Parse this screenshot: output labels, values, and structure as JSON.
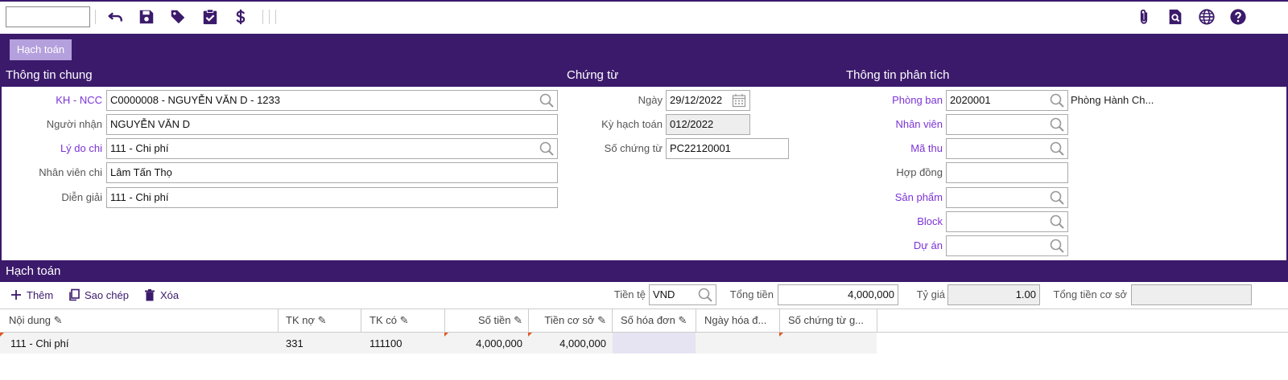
{
  "toolbar": {
    "search_value": "",
    "left_icons": [
      "undo-icon",
      "save-icon",
      "tag-icon",
      "clipboard-check-icon",
      "dollar-icon"
    ],
    "right_icons": [
      "paperclip-icon",
      "document-search-icon",
      "globe-icon",
      "help-icon"
    ],
    "icon_color": "#3b1a6b"
  },
  "tabs": {
    "active": "Hạch toán"
  },
  "sections": {
    "general": "Thông tin chung",
    "voucher": "Chứng từ",
    "analysis": "Thông tin phân tích",
    "accounting": "Hạch toán"
  },
  "general": {
    "customer_label": "KH - NCC",
    "customer_value": "C0000008 - NGUYỄN VĂN D - 1233",
    "receiver_label": "Người nhận",
    "receiver_value": "NGUYỄN VĂN D",
    "reason_label": "Lý do chi",
    "reason_value": "111 - Chi phí",
    "employee_label": "Nhân viên chi",
    "employee_value": "Lâm Tấn Thọ",
    "description_label": "Diễn giải",
    "description_value": "111 - Chi phí"
  },
  "voucher": {
    "date_label": "Ngày",
    "date_value": "29/12/2022",
    "period_label": "Kỳ hạch toán",
    "period_value": "012/2022",
    "number_label": "Số chứng từ",
    "number_value": "PC22120001"
  },
  "analysis": {
    "department_label": "Phòng ban",
    "department_value": "2020001",
    "department_name": "Phòng Hành Ch...",
    "staff_label": "Nhân viên",
    "staff_value": "",
    "code_label": "Mã thu",
    "code_value": "",
    "contract_label": "Hợp đồng",
    "contract_value": "",
    "product_label": "Sản phẩm",
    "product_value": "",
    "block_label": "Block",
    "block_value": "",
    "project_label": "Dự án",
    "project_value": ""
  },
  "actions": {
    "add": "Thêm",
    "copy": "Sao chép",
    "delete": "Xóa"
  },
  "currency": {
    "label": "Tiền tệ",
    "value": "VND",
    "total_label": "Tổng tiền",
    "total_value": "4,000,000",
    "rate_label": "Tỷ giá",
    "rate_value": "1.00",
    "base_total_label": "Tổng tiền cơ sở",
    "base_total_value": ""
  },
  "grid": {
    "columns": [
      "Nội dung",
      "TK nợ",
      "TK có",
      "Số tiền",
      "Tiền cơ sở",
      "Số hóa đơn",
      "Ngày hóa đ...",
      "Số chứng từ g..."
    ],
    "rows": [
      [
        "111 - Chi phí",
        "331",
        "111100",
        "4,000,000",
        "4,000,000",
        "",
        "",
        ""
      ]
    ]
  },
  "colors": {
    "brand": "#3b1a6b",
    "link_label": "#7b33d6",
    "tab_bg": "#b4a0dc"
  }
}
